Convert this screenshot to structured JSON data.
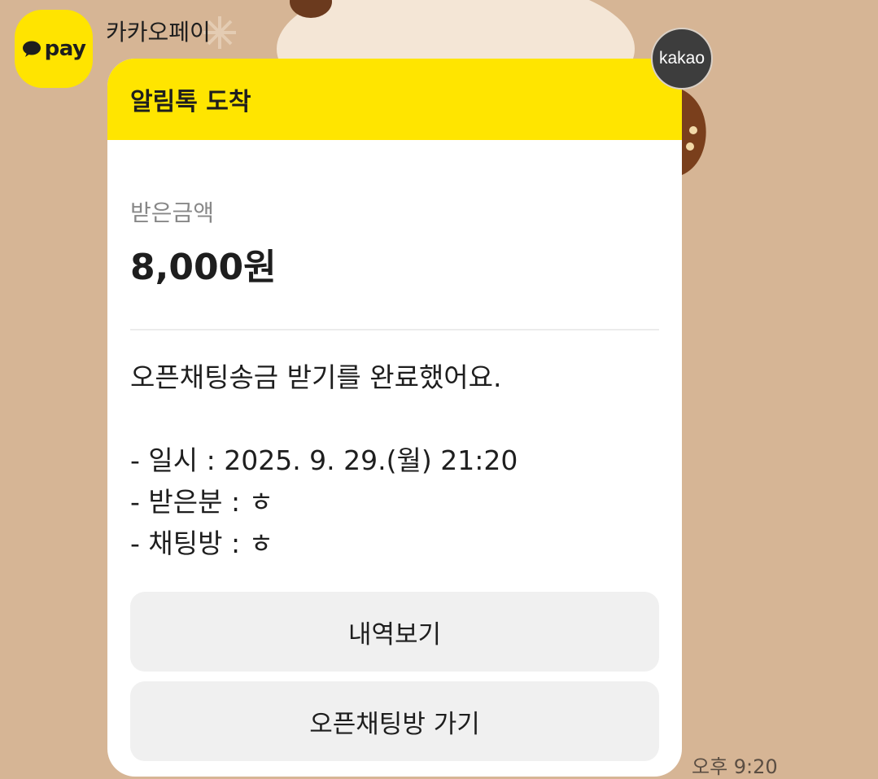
{
  "sender": {
    "avatar_text": "pay",
    "name": "카카오페이"
  },
  "badge": {
    "text": "kakao"
  },
  "card": {
    "header_title": "알림톡 도착",
    "amount_label": "받은금액",
    "amount_value": "8,000원",
    "message_lines": [
      "오픈채팅송금 받기를 완료했어요.",
      "",
      "- 일시 : 2025. 9. 29.(월) 21:20",
      "- 받은분 : ㅎ",
      "- 채팅방 : ㅎ"
    ],
    "buttons": [
      "내역보기",
      "오픈채팅방 가기"
    ]
  },
  "timestamp": "오후 9:20",
  "colors": {
    "background": "#d6b595",
    "header_yellow": "#ffe500",
    "avatar_yellow": "#ffe400",
    "button_gray": "#f0f0f0",
    "badge_dark": "#3d3d3d"
  }
}
